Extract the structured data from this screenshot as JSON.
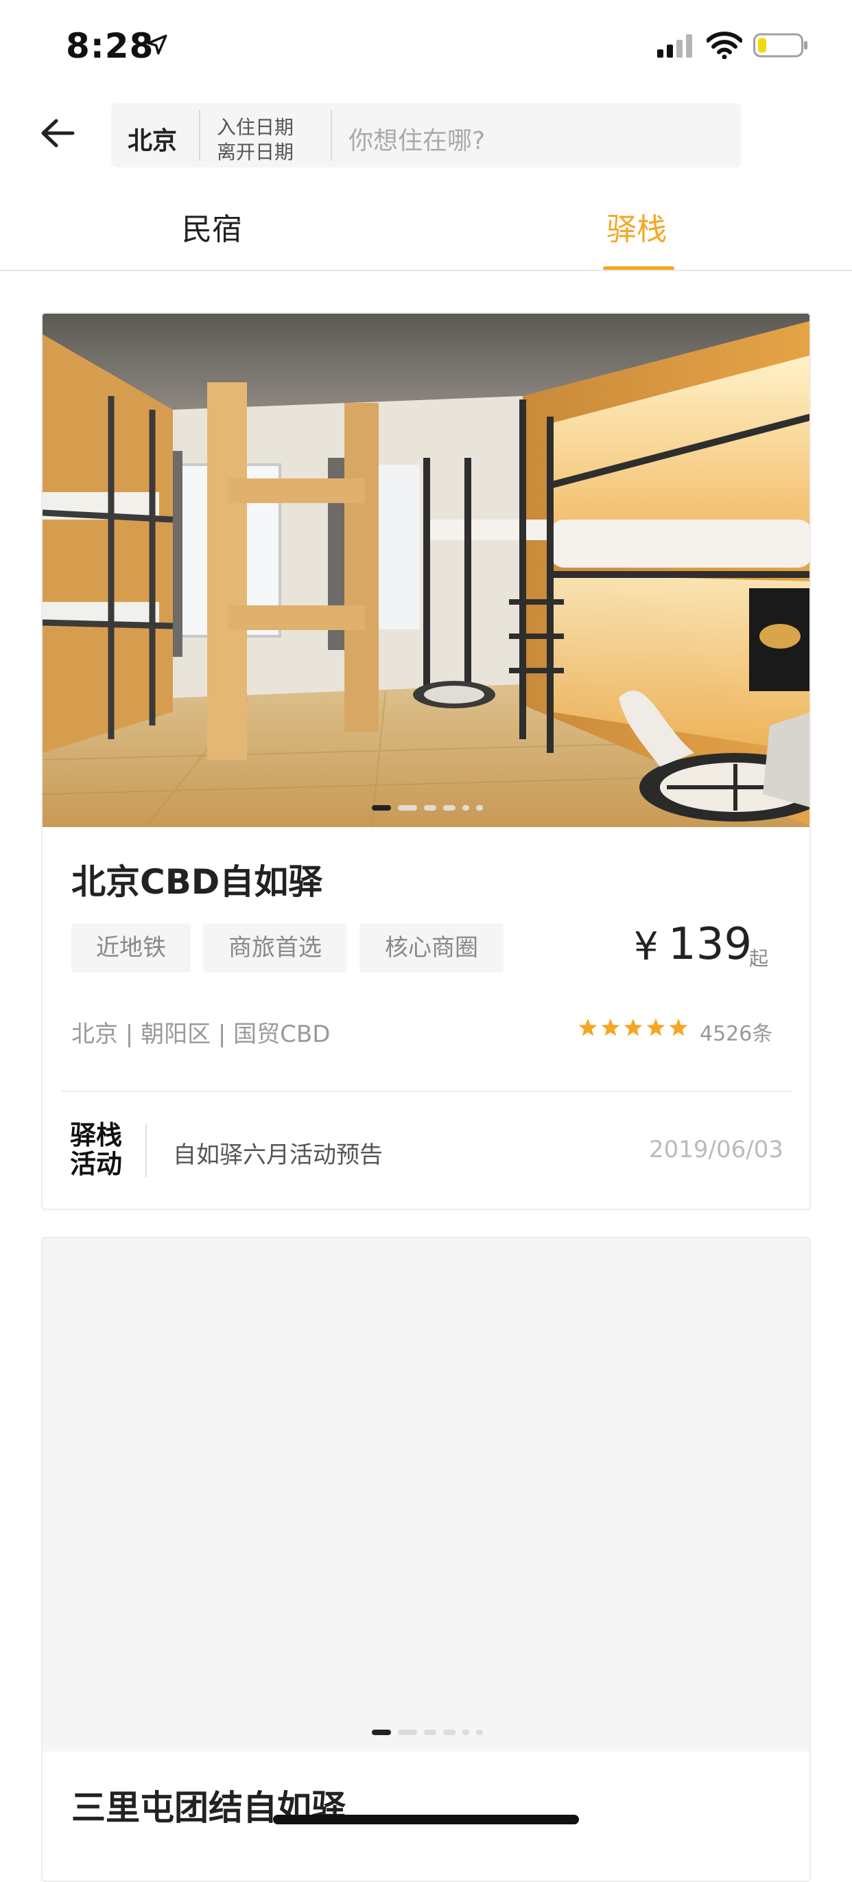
{
  "status_bar": {
    "time": "8:28",
    "icons": [
      "location-arrow-icon",
      "cellular-signal-icon",
      "wifi-icon",
      "battery-icon"
    ],
    "battery_color": "#f5d90a"
  },
  "header": {
    "back_icon": "arrow-left-icon",
    "city": "北京",
    "check_in": "入住日期",
    "check_out": "离开日期",
    "search_placeholder": "你想住在哪?"
  },
  "tabs": [
    {
      "label": "民宿",
      "active": false
    },
    {
      "label": "驿栈",
      "active": true
    }
  ],
  "accent_color": "#f5a623",
  "listings": [
    {
      "name": "北京CBD自如驿",
      "tags": [
        "近地铁",
        "商旅首选",
        "核心商圈"
      ],
      "price_symbol": "¥",
      "price": "139",
      "price_unit": "起",
      "address": "北京 | 朝阳区 | 国贸CBD",
      "rating_stars": 5,
      "reviews": "4526条",
      "photo_count": 6,
      "active_photo": 1,
      "activity": {
        "logo_line1": "驿栈",
        "logo_line2": "活动",
        "text": "自如驿六月活动预告",
        "date": "2019/06/03"
      }
    },
    {
      "name": "三里屯团结自如驿",
      "photo_count": 6,
      "active_photo": 1
    }
  ]
}
